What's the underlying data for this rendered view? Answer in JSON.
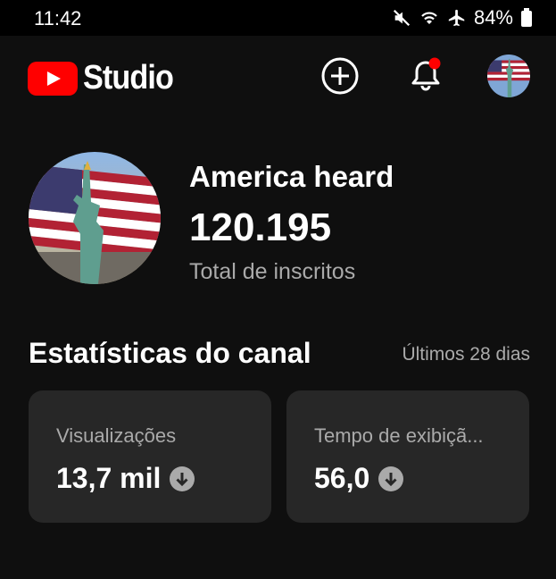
{
  "status_bar": {
    "time": "11:42",
    "battery": "84%"
  },
  "header": {
    "brand": "Studio",
    "icons": [
      "create-icon",
      "notifications-icon"
    ]
  },
  "channel": {
    "name": "America heard",
    "subscribers": "120.195",
    "subscribers_label": "Total de inscritos"
  },
  "stats": {
    "title": "Estatísticas do canal",
    "range": "Últimos 28 dias",
    "cards": [
      {
        "label": "Visualizações",
        "value": "13,7 mil",
        "trend": "down"
      },
      {
        "label": "Tempo de exibiçã...",
        "value": "56,0",
        "trend": "down"
      }
    ]
  },
  "colors": {
    "brand_red": "#ff0000",
    "background": "#0f0f0f",
    "card": "#272727",
    "notification_dot": "#ff0000"
  }
}
